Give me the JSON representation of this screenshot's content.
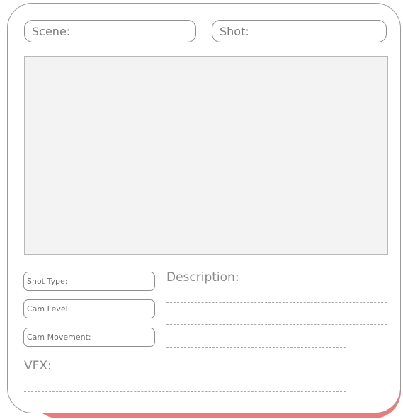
{
  "header": {
    "scene_label": "Scene:",
    "shot_label": "Shot:"
  },
  "fields": {
    "shot_type": "Shot Type:",
    "cam_level": "Cam Level:",
    "cam_movement": "Cam Movement:"
  },
  "description": {
    "label": "Description:"
  },
  "vfx": {
    "label": "VFX:"
  },
  "colors": {
    "shadow_card": "#ec7b7b",
    "frame_fill": "#f3f3f4",
    "border": "#9a9a9a"
  }
}
